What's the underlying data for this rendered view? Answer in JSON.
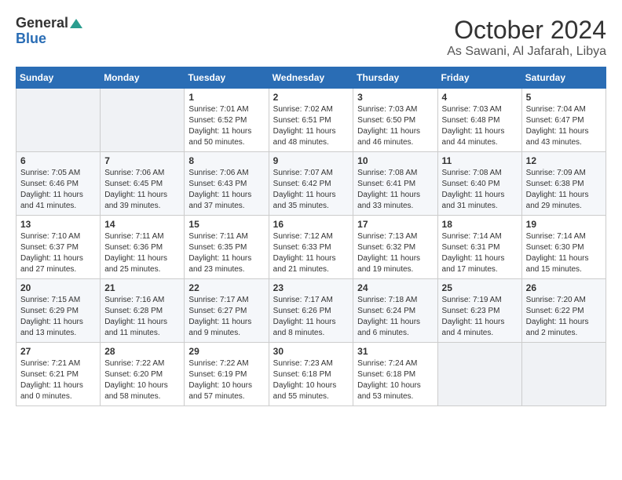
{
  "logo": {
    "line1": "General",
    "line2": "Blue"
  },
  "header": {
    "month": "October 2024",
    "location": "As Sawani, Al Jafarah, Libya"
  },
  "weekdays": [
    "Sunday",
    "Monday",
    "Tuesday",
    "Wednesday",
    "Thursday",
    "Friday",
    "Saturday"
  ],
  "weeks": [
    [
      null,
      null,
      {
        "day": 1,
        "sunrise": "Sunrise: 7:01 AM",
        "sunset": "Sunset: 6:52 PM",
        "daylight": "Daylight: 11 hours and 50 minutes."
      },
      {
        "day": 2,
        "sunrise": "Sunrise: 7:02 AM",
        "sunset": "Sunset: 6:51 PM",
        "daylight": "Daylight: 11 hours and 48 minutes."
      },
      {
        "day": 3,
        "sunrise": "Sunrise: 7:03 AM",
        "sunset": "Sunset: 6:50 PM",
        "daylight": "Daylight: 11 hours and 46 minutes."
      },
      {
        "day": 4,
        "sunrise": "Sunrise: 7:03 AM",
        "sunset": "Sunset: 6:48 PM",
        "daylight": "Daylight: 11 hours and 44 minutes."
      },
      {
        "day": 5,
        "sunrise": "Sunrise: 7:04 AM",
        "sunset": "Sunset: 6:47 PM",
        "daylight": "Daylight: 11 hours and 43 minutes."
      }
    ],
    [
      {
        "day": 6,
        "sunrise": "Sunrise: 7:05 AM",
        "sunset": "Sunset: 6:46 PM",
        "daylight": "Daylight: 11 hours and 41 minutes."
      },
      {
        "day": 7,
        "sunrise": "Sunrise: 7:06 AM",
        "sunset": "Sunset: 6:45 PM",
        "daylight": "Daylight: 11 hours and 39 minutes."
      },
      {
        "day": 8,
        "sunrise": "Sunrise: 7:06 AM",
        "sunset": "Sunset: 6:43 PM",
        "daylight": "Daylight: 11 hours and 37 minutes."
      },
      {
        "day": 9,
        "sunrise": "Sunrise: 7:07 AM",
        "sunset": "Sunset: 6:42 PM",
        "daylight": "Daylight: 11 hours and 35 minutes."
      },
      {
        "day": 10,
        "sunrise": "Sunrise: 7:08 AM",
        "sunset": "Sunset: 6:41 PM",
        "daylight": "Daylight: 11 hours and 33 minutes."
      },
      {
        "day": 11,
        "sunrise": "Sunrise: 7:08 AM",
        "sunset": "Sunset: 6:40 PM",
        "daylight": "Daylight: 11 hours and 31 minutes."
      },
      {
        "day": 12,
        "sunrise": "Sunrise: 7:09 AM",
        "sunset": "Sunset: 6:38 PM",
        "daylight": "Daylight: 11 hours and 29 minutes."
      }
    ],
    [
      {
        "day": 13,
        "sunrise": "Sunrise: 7:10 AM",
        "sunset": "Sunset: 6:37 PM",
        "daylight": "Daylight: 11 hours and 27 minutes."
      },
      {
        "day": 14,
        "sunrise": "Sunrise: 7:11 AM",
        "sunset": "Sunset: 6:36 PM",
        "daylight": "Daylight: 11 hours and 25 minutes."
      },
      {
        "day": 15,
        "sunrise": "Sunrise: 7:11 AM",
        "sunset": "Sunset: 6:35 PM",
        "daylight": "Daylight: 11 hours and 23 minutes."
      },
      {
        "day": 16,
        "sunrise": "Sunrise: 7:12 AM",
        "sunset": "Sunset: 6:33 PM",
        "daylight": "Daylight: 11 hours and 21 minutes."
      },
      {
        "day": 17,
        "sunrise": "Sunrise: 7:13 AM",
        "sunset": "Sunset: 6:32 PM",
        "daylight": "Daylight: 11 hours and 19 minutes."
      },
      {
        "day": 18,
        "sunrise": "Sunrise: 7:14 AM",
        "sunset": "Sunset: 6:31 PM",
        "daylight": "Daylight: 11 hours and 17 minutes."
      },
      {
        "day": 19,
        "sunrise": "Sunrise: 7:14 AM",
        "sunset": "Sunset: 6:30 PM",
        "daylight": "Daylight: 11 hours and 15 minutes."
      }
    ],
    [
      {
        "day": 20,
        "sunrise": "Sunrise: 7:15 AM",
        "sunset": "Sunset: 6:29 PM",
        "daylight": "Daylight: 11 hours and 13 minutes."
      },
      {
        "day": 21,
        "sunrise": "Sunrise: 7:16 AM",
        "sunset": "Sunset: 6:28 PM",
        "daylight": "Daylight: 11 hours and 11 minutes."
      },
      {
        "day": 22,
        "sunrise": "Sunrise: 7:17 AM",
        "sunset": "Sunset: 6:27 PM",
        "daylight": "Daylight: 11 hours and 9 minutes."
      },
      {
        "day": 23,
        "sunrise": "Sunrise: 7:17 AM",
        "sunset": "Sunset: 6:26 PM",
        "daylight": "Daylight: 11 hours and 8 minutes."
      },
      {
        "day": 24,
        "sunrise": "Sunrise: 7:18 AM",
        "sunset": "Sunset: 6:24 PM",
        "daylight": "Daylight: 11 hours and 6 minutes."
      },
      {
        "day": 25,
        "sunrise": "Sunrise: 7:19 AM",
        "sunset": "Sunset: 6:23 PM",
        "daylight": "Daylight: 11 hours and 4 minutes."
      },
      {
        "day": 26,
        "sunrise": "Sunrise: 7:20 AM",
        "sunset": "Sunset: 6:22 PM",
        "daylight": "Daylight: 11 hours and 2 minutes."
      }
    ],
    [
      {
        "day": 27,
        "sunrise": "Sunrise: 7:21 AM",
        "sunset": "Sunset: 6:21 PM",
        "daylight": "Daylight: 11 hours and 0 minutes."
      },
      {
        "day": 28,
        "sunrise": "Sunrise: 7:22 AM",
        "sunset": "Sunset: 6:20 PM",
        "daylight": "Daylight: 10 hours and 58 minutes."
      },
      {
        "day": 29,
        "sunrise": "Sunrise: 7:22 AM",
        "sunset": "Sunset: 6:19 PM",
        "daylight": "Daylight: 10 hours and 57 minutes."
      },
      {
        "day": 30,
        "sunrise": "Sunrise: 7:23 AM",
        "sunset": "Sunset: 6:18 PM",
        "daylight": "Daylight: 10 hours and 55 minutes."
      },
      {
        "day": 31,
        "sunrise": "Sunrise: 7:24 AM",
        "sunset": "Sunset: 6:18 PM",
        "daylight": "Daylight: 10 hours and 53 minutes."
      },
      null,
      null
    ]
  ]
}
